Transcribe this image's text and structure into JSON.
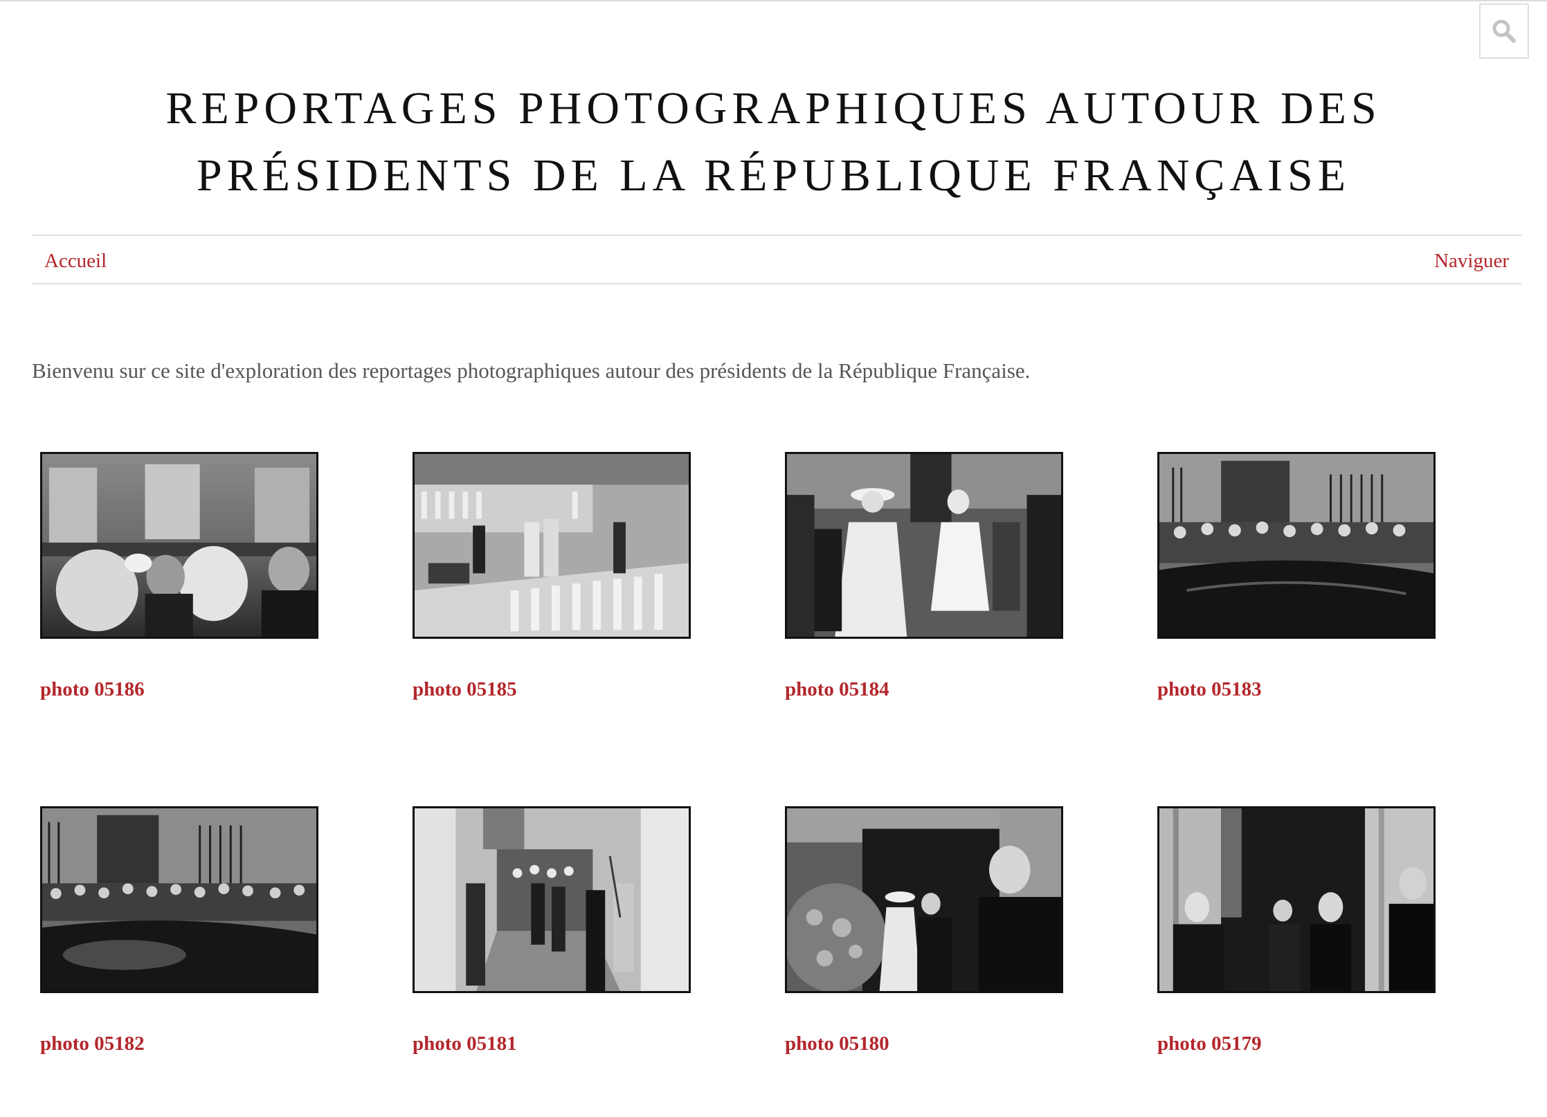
{
  "header": {
    "title_line1": "REPORTAGES PHOTOGRAPHIQUES AUTOUR DES",
    "title_line2": "PRÉSIDENTS DE LA RÉPUBLIQUE FRANÇAISE",
    "search_icon": "search-icon"
  },
  "nav": {
    "home_label": "Accueil",
    "browse_label": "Naviguer"
  },
  "intro": {
    "text": "Bienvenu sur ce site d'exploration des reportages photographiques autour des présidents de la République Française."
  },
  "gallery": {
    "items": [
      {
        "caption": "photo 05186"
      },
      {
        "caption": "photo 05185"
      },
      {
        "caption": "photo 05184"
      },
      {
        "caption": "photo 05183"
      },
      {
        "caption": "photo 05182"
      },
      {
        "caption": "photo 05181"
      },
      {
        "caption": "photo 05180"
      },
      {
        "caption": "photo 05179"
      }
    ]
  },
  "colors": {
    "accent": "#b3262c",
    "text": "#555555",
    "title": "#111111",
    "rule": "#dedede"
  }
}
